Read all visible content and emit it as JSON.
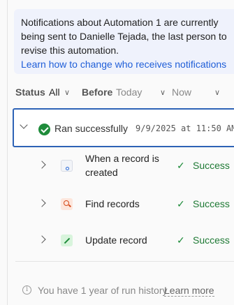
{
  "banner": {
    "text": "Notifications about Automation 1 are currently being sent to Danielle Tejada, the last person to revise this automation.",
    "link": "Learn how to change who receives notifications"
  },
  "filters": {
    "status_label": "Status",
    "status_value": "All",
    "before_label": "Before",
    "from_placeholder": "Today",
    "to_placeholder": "Now"
  },
  "run": {
    "status": "Ran successfully",
    "timestamp": "9/9/2025 at 11:50 AM"
  },
  "steps": [
    {
      "label": "When a record is created",
      "status": "Success",
      "icon": "record-trigger-icon"
    },
    {
      "label": "Find records",
      "status": "Success",
      "icon": "search-icon"
    },
    {
      "label": "Update record",
      "status": "Success",
      "icon": "pencil-icon"
    }
  ],
  "footer": {
    "message": "You have 1 year of run history",
    "link": "Learn more"
  },
  "colors": {
    "accent": "#2e63b6",
    "success": "#1f8c3b",
    "link": "#1f5ed8",
    "banner_bg": "#eff2fc"
  }
}
